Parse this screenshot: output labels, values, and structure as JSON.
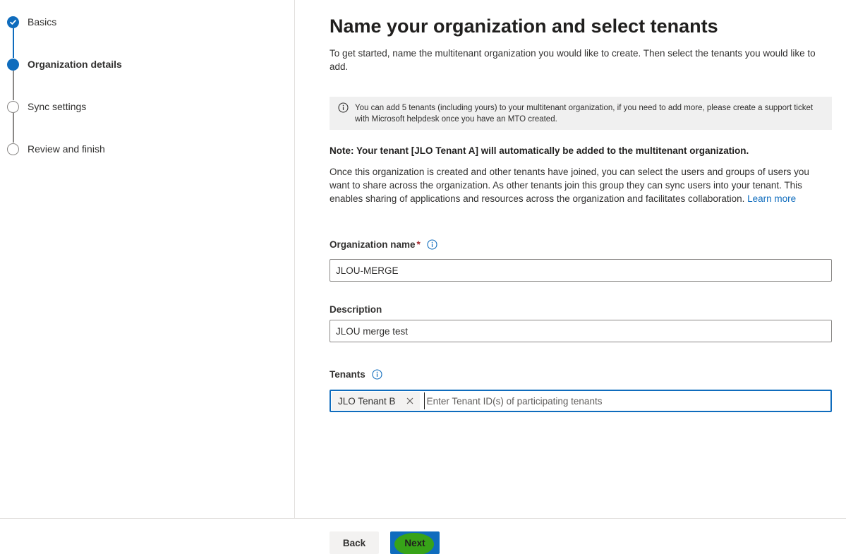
{
  "stepper": {
    "steps": [
      {
        "label": "Basics",
        "state": "completed"
      },
      {
        "label": "Organization details",
        "state": "current"
      },
      {
        "label": "Sync settings",
        "state": "pending"
      },
      {
        "label": "Review and finish",
        "state": "pending"
      }
    ]
  },
  "main": {
    "title": "Name your organization and select tenants",
    "intro": "To get started, name the multitenant organization you would like to create. Then select the tenants you would like to add.",
    "info_message": "You can add 5 tenants (including yours) to your multitenant organization, if you need to add more, please create a support ticket with Microsoft helpdesk once you have an MTO created.",
    "note": "Note: Your tenant [JLO Tenant A] will automatically be added to the multitenant organization.",
    "explanation": "Once this organization is created and other tenants have joined, you can select the users and groups of users you want to share across the organization. As other tenants join this group they can sync users into your tenant. This enables sharing of applications and resources across the organization and facilitates collaboration.",
    "learn_more": "Learn more",
    "org_name": {
      "label": "Organization name",
      "required_mark": "*",
      "value": "JLOU-MERGE"
    },
    "description": {
      "label": "Description",
      "value": "JLOU merge test"
    },
    "tenants": {
      "label": "Tenants",
      "selected": [
        "JLO Tenant B"
      ],
      "placeholder": "Enter Tenant ID(s) of participating tenants"
    }
  },
  "footer": {
    "back_label": "Back",
    "next_label": "Next"
  },
  "colors": {
    "accent": "#0f6cbd",
    "required": "#a4262c",
    "highlight": "#3aa60f"
  }
}
